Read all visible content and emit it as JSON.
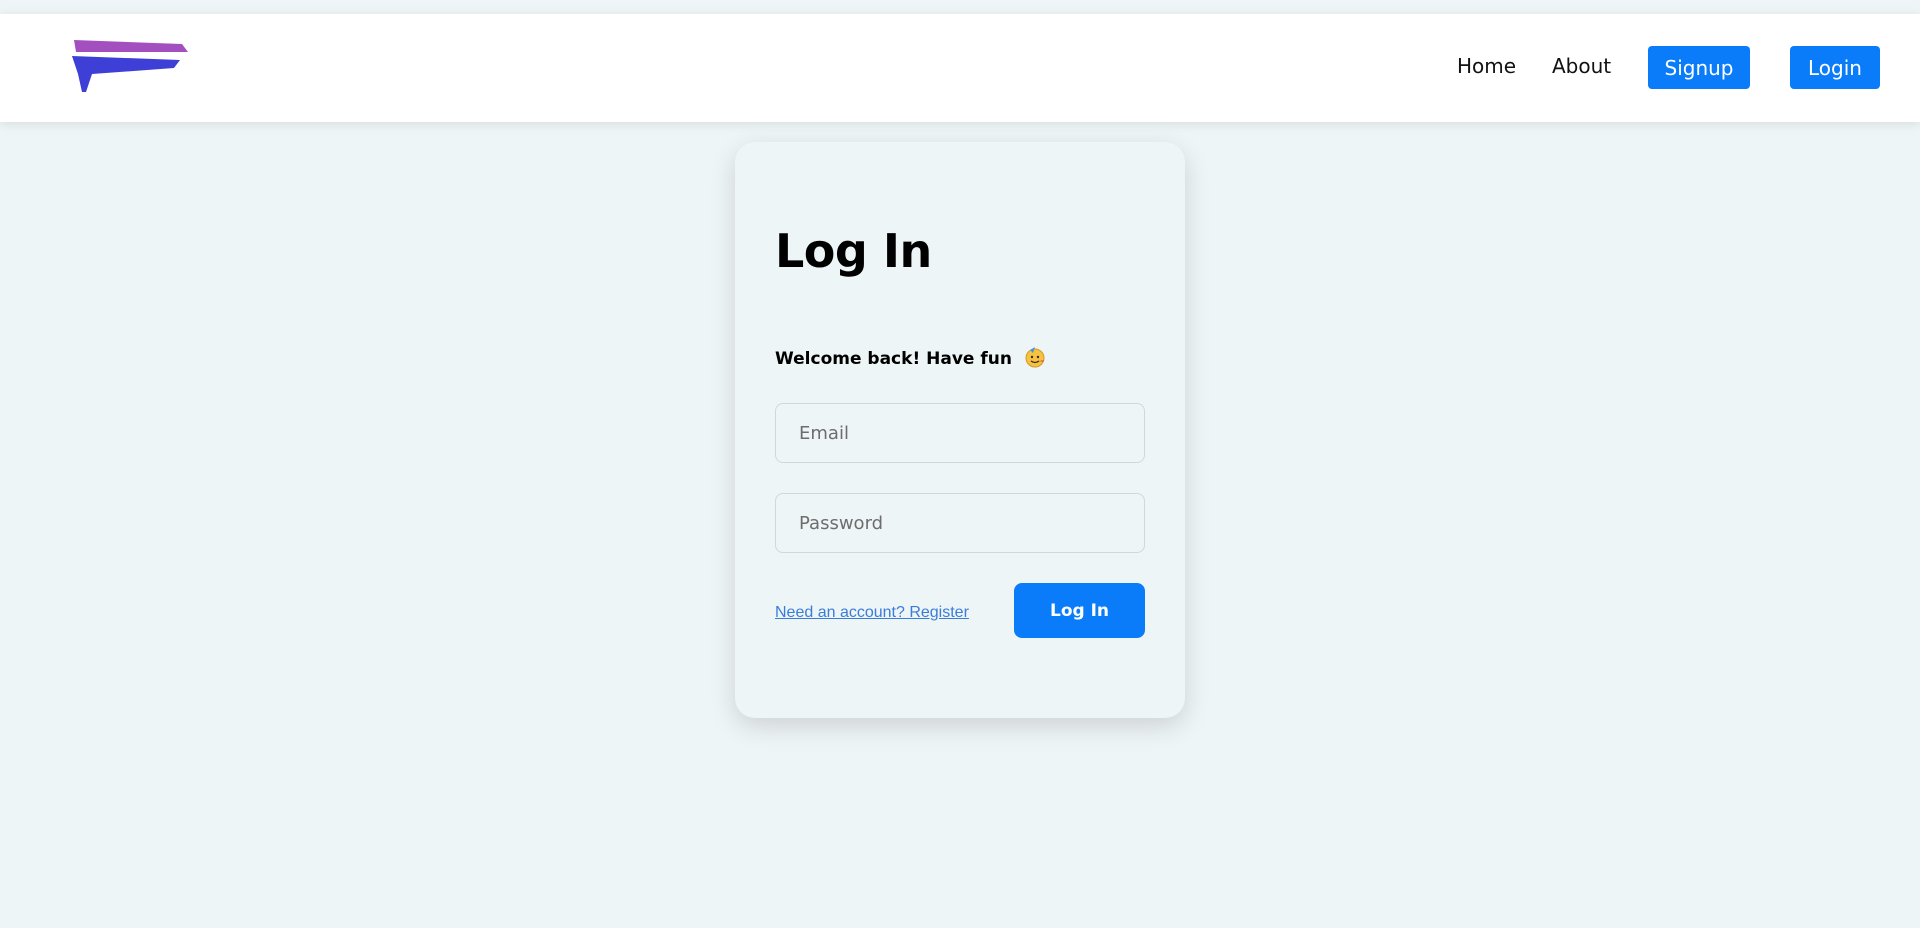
{
  "nav": {
    "logo_icon": "brush-stroke-logo-icon",
    "links": [
      "Home",
      "About"
    ],
    "signup_label": "Signup",
    "login_label": "Login"
  },
  "card": {
    "title": "Log In",
    "welcome": "Welcome back! Have fun",
    "welcome_emoji_icon": "party-face-icon",
    "email_placeholder": "Email",
    "password_placeholder": "Password",
    "register_link": "Need an account? Register",
    "submit_label": "Log In"
  },
  "colors": {
    "accent": "#0a7cfa",
    "page_bg": "#eef5f7",
    "link": "#3a7dd8",
    "logo_purple": "#a34fbf",
    "logo_blue": "#3d3fd6"
  }
}
